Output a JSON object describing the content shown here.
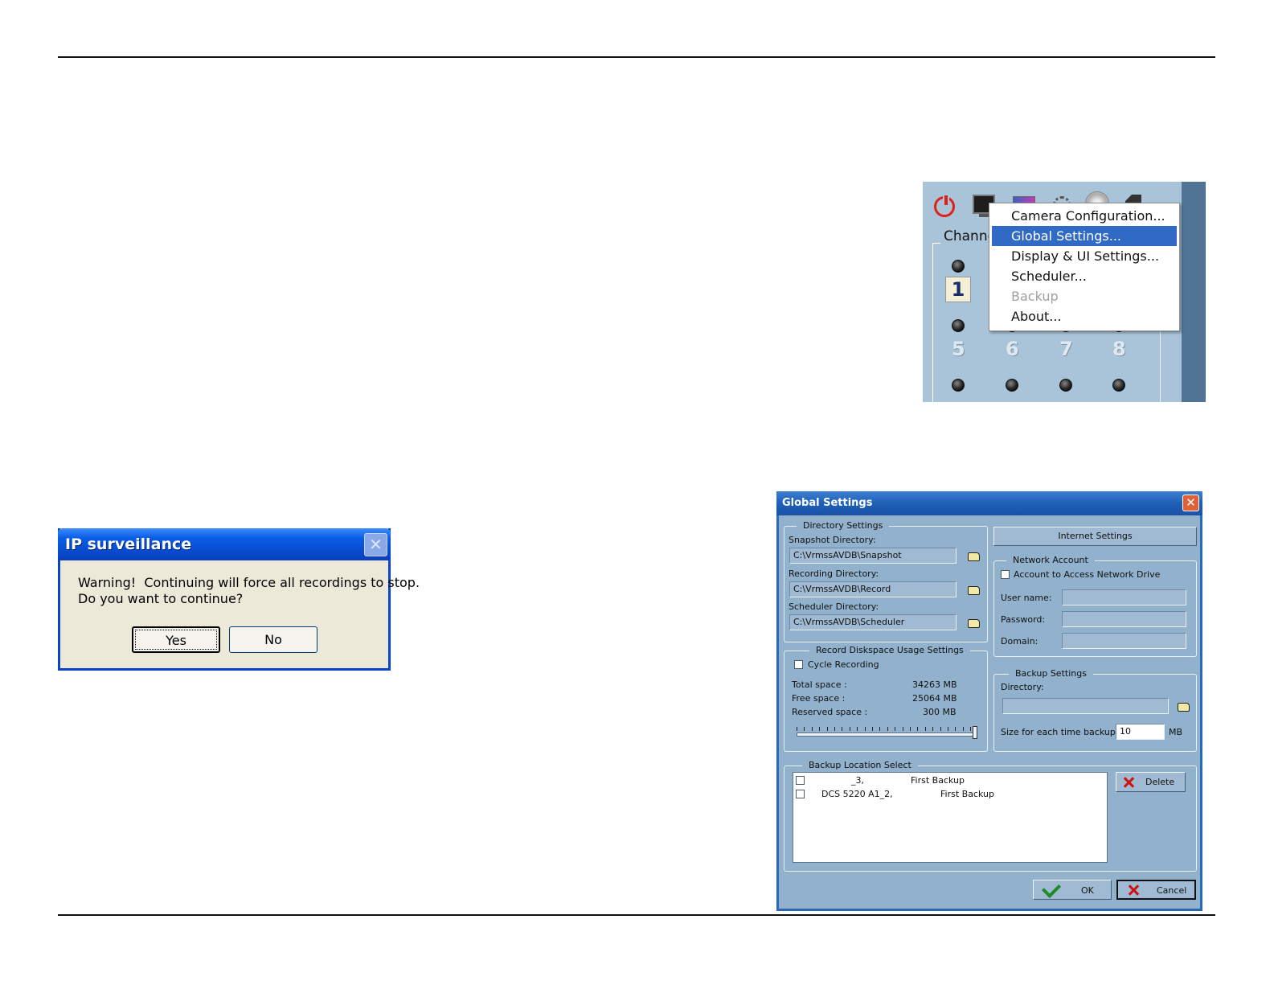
{
  "menu_panel": {
    "channel_label": "Channel",
    "active_channel": "1",
    "channel_numbers": [
      "5",
      "6",
      "7",
      "8"
    ],
    "menu_items": [
      {
        "label": "Camera Configuration...",
        "state": "normal"
      },
      {
        "label": "Global Settings...",
        "state": "selected"
      },
      {
        "label": "Display & UI Settings...",
        "state": "normal"
      },
      {
        "label": "Scheduler...",
        "state": "normal"
      },
      {
        "label": "Backup",
        "state": "disabled"
      },
      {
        "label": "About...",
        "state": "normal"
      }
    ]
  },
  "warning_dialog": {
    "title": "IP surveillance",
    "message": "Warning!  Continuing will force all recordings to stop.\nDo you want to continue?",
    "yes_label": "Yes",
    "no_label": "No"
  },
  "global_settings": {
    "title": "Global Settings",
    "directory_settings": {
      "group_label": "Directory Settings",
      "snapshot_label": "Snapshot Directory:",
      "snapshot_value": "C:\\VrmssAVDB\\Snapshot",
      "recording_label": "Recording Directory:",
      "recording_value": "C:\\VrmssAVDB\\Record",
      "scheduler_label": "Scheduler Directory:",
      "scheduler_value": "C:\\VrmssAVDB\\Scheduler"
    },
    "internet_settings_label": "Internet Settings",
    "network_account": {
      "group_label": "Network Account",
      "checkbox_label": "Account to Access Network Drive",
      "username_label": "User name:",
      "password_label": "Password:",
      "domain_label": "Domain:"
    },
    "diskspace": {
      "group_label": "Record Diskspace Usage Settings",
      "cycle_label": "Cycle Recording",
      "total_label": "Total space :",
      "total_value": "34263 MB",
      "free_label": "Free space :",
      "free_value": "25064 MB",
      "reserved_label": "Reserved space :",
      "reserved_value": "300 MB"
    },
    "backup_settings": {
      "group_label": "Backup Settings",
      "directory_label": "Directory:",
      "directory_value": "",
      "size_label": "Size for each time backup:",
      "size_value": "10",
      "size_unit": "MB"
    },
    "backup_location": {
      "group_label": "Backup Location Select",
      "rows": [
        {
          "name": "_3,",
          "type": "First Backup"
        },
        {
          "name": "DCS 5220  A1_2,",
          "type": "First Backup"
        }
      ],
      "delete_label": "Delete"
    },
    "ok_label": "OK",
    "cancel_label": "Cancel"
  }
}
